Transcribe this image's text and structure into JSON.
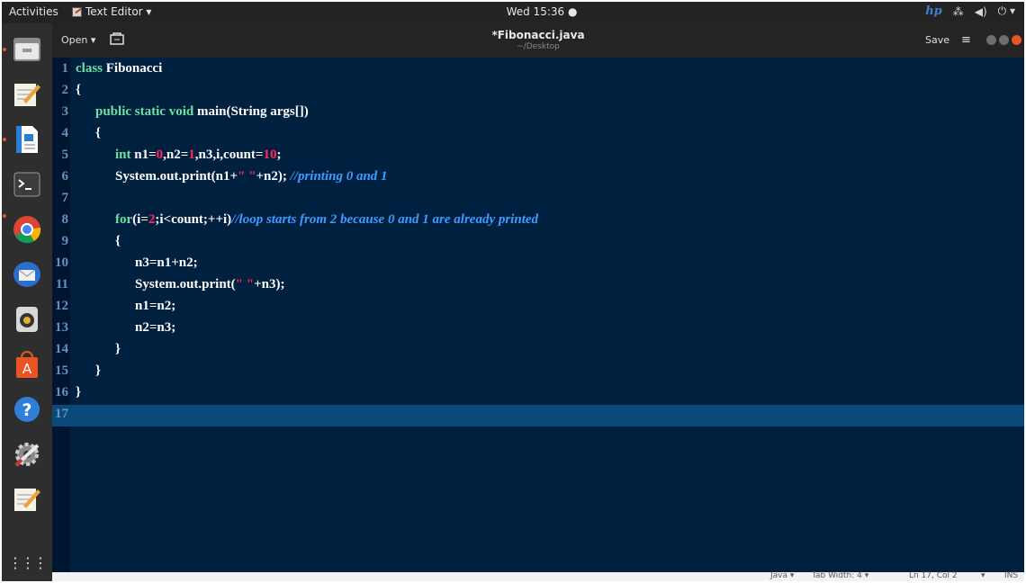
{
  "top_panel": {
    "activities": "Activities",
    "app_name": "Text Editor ▾",
    "clock": "Wed 15:36 ●",
    "brand": "hp",
    "tray": {
      "network": "⁂",
      "volume": "◀)",
      "power": "⏻ ▾"
    }
  },
  "dock": {
    "items": [
      {
        "name": "files"
      },
      {
        "name": "text-editor"
      },
      {
        "name": "libreoffice-writer"
      },
      {
        "name": "terminal"
      },
      {
        "name": "chrome"
      },
      {
        "name": "thunderbird"
      },
      {
        "name": "rhythmbox"
      },
      {
        "name": "software-center"
      },
      {
        "name": "help"
      },
      {
        "name": "system-settings"
      },
      {
        "name": "gedit"
      }
    ],
    "app_grid": "⋮⋮⋮"
  },
  "header": {
    "open_label": "Open ▾",
    "title": "*Fibonacci.java",
    "path": "~/Desktop",
    "save_label": "Save",
    "menu_label": "≡"
  },
  "editor": {
    "lines": [
      "class Fibonacci",
      "{",
      "public static void main(String args[])",
      "{",
      "int n1=0,n2=1,n3,i,count=10;",
      "System.out.print(n1+\" \"+n2); //printing 0 and 1",
      "",
      "for(i=2;i<count;++i)//loop starts from 2 because 0 and 1 are already printed",
      "{",
      "n3=n1+n2;",
      "System.out.print(\" \"+n3);",
      "n1=n2;",
      "n2=n3;",
      "}",
      "}",
      "}",
      ""
    ],
    "current_line": 17
  },
  "status": {
    "language": "Java ▾",
    "tab_width": "Tab Width: 4 ▾",
    "position": "Ln 17, Col 2",
    "extra": "▾",
    "mode": "INS"
  },
  "colors": {
    "editor_bg": "#002040",
    "keyword": "#6ee0a0",
    "number": "#ff2a5a",
    "comment": "#3e9cff",
    "current_line": "#0a4a7a"
  }
}
